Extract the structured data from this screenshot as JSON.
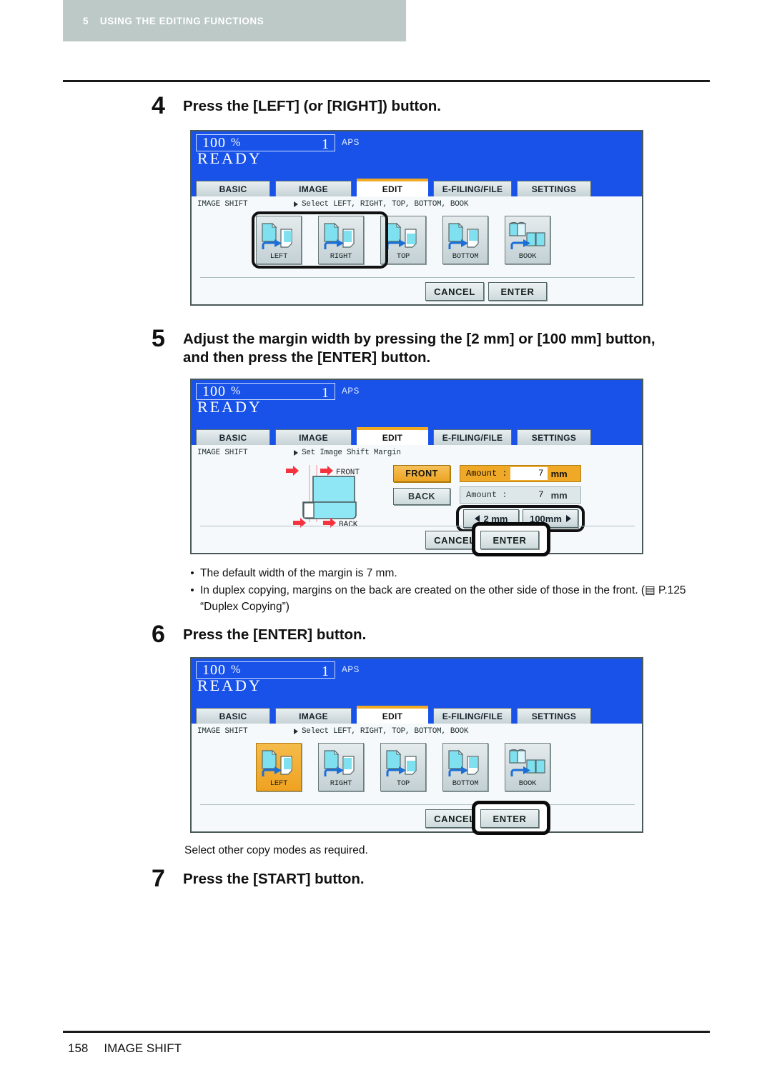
{
  "header": {
    "chapter_number": "5",
    "chapter_title": "USING THE EDITING FUNCTIONS"
  },
  "steps": [
    {
      "number": "4",
      "line1": "Press the [LEFT] (or [RIGHT]) button.",
      "line2": ""
    },
    {
      "number": "5",
      "line1": "Adjust the margin width by pressing the [2 mm] or [100 mm] button,",
      "line2": "and then press the [ENTER] button."
    },
    {
      "number": "6",
      "line1": "Press the [ENTER] button.",
      "line2": ""
    },
    {
      "number": "7",
      "line1": "Press the [START] button.",
      "line2": ""
    }
  ],
  "panel_common": {
    "ratio": "100",
    "percent": "%",
    "copies": "1",
    "paper_mode": "APS",
    "status": "READY",
    "tabs": [
      {
        "label": "BASIC",
        "active": false
      },
      {
        "label": "IMAGE",
        "active": false
      },
      {
        "label": "EDIT",
        "active": true
      },
      {
        "label": "E-FILING/FILE",
        "active": false
      },
      {
        "label": "SETTINGS",
        "active": false
      }
    ],
    "function_name": "IMAGE SHIFT",
    "cancel_label": "CANCEL",
    "enter_label": "ENTER"
  },
  "panel_step4": {
    "instruction": "Select LEFT, RIGHT, TOP, BOTTOM, BOOK",
    "modes": [
      {
        "label": "LEFT",
        "selected": false,
        "highlighted": true
      },
      {
        "label": "RIGHT",
        "selected": false,
        "highlighted": true
      },
      {
        "label": "TOP",
        "selected": false,
        "highlighted": false
      },
      {
        "label": "BOTTOM",
        "selected": false,
        "highlighted": false
      },
      {
        "label": "BOOK",
        "selected": false,
        "highlighted": false
      }
    ],
    "enter_highlighted": false
  },
  "panel_step5": {
    "instruction": "Set Image Shift Margin",
    "diagram": {
      "front_label": "FRONT",
      "back_label": "BACK"
    },
    "side_buttons": [
      {
        "label": "FRONT",
        "selected": true
      },
      {
        "label": "BACK",
        "selected": false
      }
    ],
    "amounts": [
      {
        "label": "Amount :",
        "value": "7",
        "unit": "mm",
        "selected": true
      },
      {
        "label": "Amount :",
        "value": "7",
        "unit": "mm",
        "selected": false
      }
    ],
    "stepper": [
      {
        "label": "2 mm",
        "arrow": "left"
      },
      {
        "label": "100mm",
        "arrow": "right"
      }
    ],
    "stepper_highlighted": true,
    "enter_highlighted": true
  },
  "panel_step6": {
    "instruction": "Select LEFT, RIGHT, TOP, BOTTOM, BOOK",
    "modes": [
      {
        "label": "LEFT",
        "selected": true,
        "highlighted": false
      },
      {
        "label": "RIGHT",
        "selected": false,
        "highlighted": false
      },
      {
        "label": "TOP",
        "selected": false,
        "highlighted": false
      },
      {
        "label": "BOTTOM",
        "selected": false,
        "highlighted": false
      },
      {
        "label": "BOOK",
        "selected": false,
        "highlighted": false
      }
    ],
    "enter_highlighted": true
  },
  "notes": {
    "bullet": "•",
    "items": [
      "The default width of the margin is 7 mm.",
      "In duplex copying, margins on the back are created on the other side of those in the front. (▤ P.125 “Duplex Copying”)"
    ]
  },
  "after_step6_text": "Select other copy modes as required.",
  "footer": {
    "page_number": "158",
    "section": "IMAGE SHIFT"
  },
  "colors": {
    "band": "#bdc9c7",
    "lcd_blue": "#1852e8",
    "tab_active_accent": "#f0aa23",
    "selected_orange": "#efa221",
    "icon_cyan": "#7fe0ef",
    "arrow_blue": "#1b6fd6",
    "diagram_red": "#f4333f"
  }
}
